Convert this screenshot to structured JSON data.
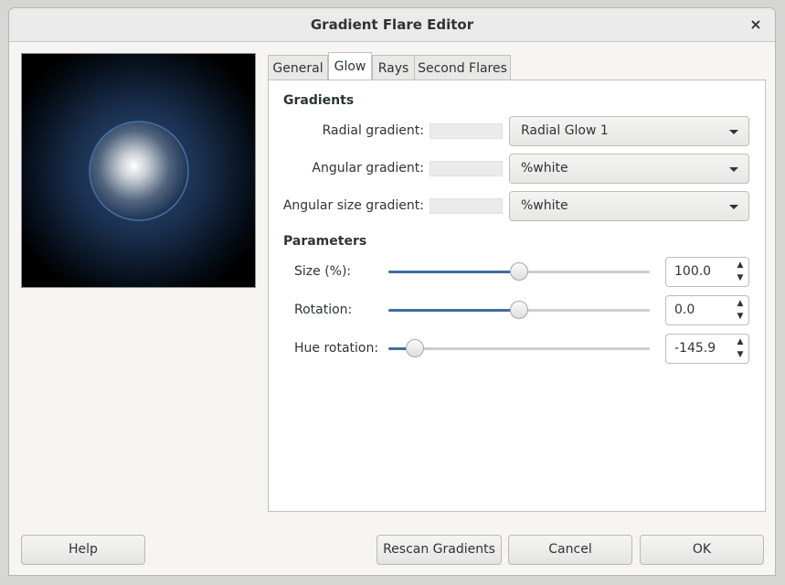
{
  "window": {
    "title": "Gradient Flare Editor",
    "close_glyph": "×"
  },
  "tabs": [
    {
      "label": "General"
    },
    {
      "label": "Glow"
    },
    {
      "label": "Rays"
    },
    {
      "label": "Second Flares"
    }
  ],
  "active_tab": "Glow",
  "gradients": {
    "section_title": "Gradients",
    "radial_label": "Radial gradient:",
    "radial_value": "Radial Glow 1",
    "angular_label": "Angular gradient:",
    "angular_value": "%white",
    "angular_size_label": "Angular size gradient:",
    "angular_size_value": "%white"
  },
  "parameters": {
    "section_title": "Parameters",
    "size_label": "Size (%):",
    "size_value": "100.0",
    "size_slider_fraction": 0.5,
    "rotation_label": "Rotation:",
    "rotation_value": "0.0",
    "rotation_slider_fraction": 0.5,
    "hue_label": "Hue rotation:",
    "hue_value": "-145.9",
    "hue_slider_fraction": 0.1
  },
  "buttons": {
    "help": "Help",
    "rescan": "Rescan Gradients",
    "cancel": "Cancel",
    "ok": "OK"
  },
  "icons": {
    "spin_up": "▲",
    "spin_down": "▼",
    "dropdown": "chevron-down-icon",
    "close": "close-icon"
  },
  "colors": {
    "accent": "#3e6fa3",
    "preview_glow": "#2a4a78"
  }
}
